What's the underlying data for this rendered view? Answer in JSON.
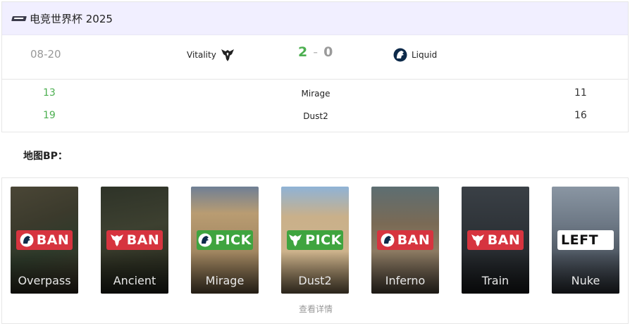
{
  "event": {
    "title": "电竞世界杯 2025",
    "logo_icon": "esports-world-cup-logo"
  },
  "match": {
    "date": "08-20",
    "team_left": {
      "name": "Vitality",
      "icon": "vitality-bee-icon"
    },
    "team_right": {
      "name": "Liquid",
      "icon": "liquid-horse-icon"
    },
    "score_left": "2",
    "score_separator": "-",
    "score_right": "0",
    "colors": {
      "win": "#4caf50",
      "lose": "#9a9a9a"
    }
  },
  "map_results": [
    {
      "left_score": "13",
      "map": "Mirage",
      "right_score": "11"
    },
    {
      "left_score": "19",
      "map": "Dust2",
      "right_score": "16"
    }
  ],
  "veto": {
    "heading": "地图BP：",
    "colors": {
      "ban": "#d6343f",
      "pick": "#3fa43f",
      "left": "#ffffff"
    },
    "items": [
      {
        "map": "Overpass",
        "action": "BAN",
        "team_icon": "liquid-horse-icon"
      },
      {
        "map": "Ancient",
        "action": "BAN",
        "team_icon": "vitality-bee-icon"
      },
      {
        "map": "Mirage",
        "action": "PICK",
        "team_icon": "liquid-horse-icon"
      },
      {
        "map": "Dust2",
        "action": "PICK",
        "team_icon": "vitality-bee-icon"
      },
      {
        "map": "Inferno",
        "action": "BAN",
        "team_icon": "liquid-horse-icon"
      },
      {
        "map": "Train",
        "action": "BAN",
        "team_icon": "vitality-bee-icon"
      },
      {
        "map": "Nuke",
        "action": "LEFT",
        "team_icon": ""
      }
    ],
    "details_link": "查看详情"
  }
}
